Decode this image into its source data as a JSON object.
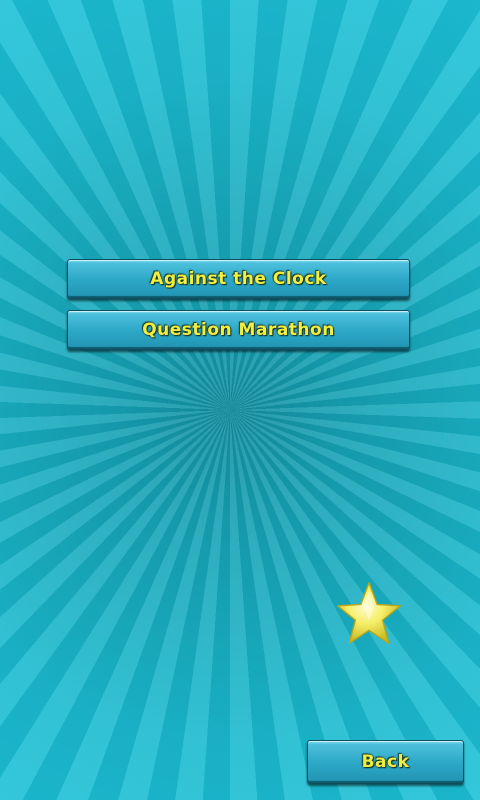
{
  "menu": {
    "items": [
      {
        "label": "Against the Clock"
      },
      {
        "label": "Question Marathon"
      }
    ]
  },
  "footer": {
    "back_label": "Back"
  },
  "decoration": {
    "star_icon": "star-icon"
  },
  "colors": {
    "background": "#1bbad0",
    "button": "#2ea9c8",
    "label": "#f2ee3f",
    "star": "#f5ef6a"
  }
}
